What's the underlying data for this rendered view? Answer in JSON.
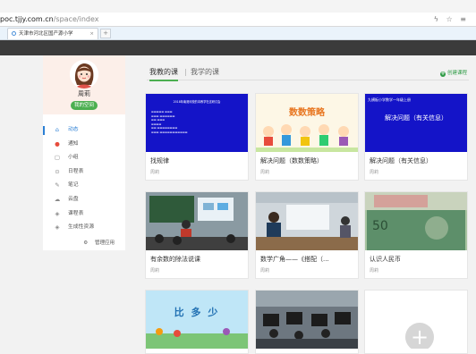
{
  "browser": {
    "url_host": "poc.tjjy.com.cn",
    "url_path": "/space/index",
    "tab_title": "天津市河北区国产源小学",
    "tab_close": "×",
    "new_tab": "+",
    "addr_icons": "ϟ ☆ ≡"
  },
  "user": {
    "name": "周莉",
    "home_button": "我的空间"
  },
  "sidebar": {
    "items": [
      {
        "icon": "home-icon",
        "glyph": "⌂",
        "label": "动态"
      },
      {
        "icon": "bell-icon",
        "glyph": "●",
        "label": "通知"
      },
      {
        "icon": "group-icon",
        "glyph": "▢",
        "label": "小组"
      },
      {
        "icon": "calendar-icon",
        "glyph": "⊙",
        "label": "日程表"
      },
      {
        "icon": "pen-icon",
        "glyph": "✎",
        "label": "笔记"
      },
      {
        "icon": "cloud-icon",
        "glyph": "☁",
        "label": "云盘"
      },
      {
        "icon": "course-icon",
        "glyph": "◈",
        "label": "课程表"
      },
      {
        "icon": "resource-icon",
        "glyph": "◈",
        "label": "生成性资源"
      }
    ],
    "manage": {
      "glyph": "⚙",
      "label": "管理应用"
    }
  },
  "course_tabs": {
    "mine": "我教的课",
    "learn": "我学的课",
    "separator": "|",
    "create": "创建课程",
    "create_glyph": "+"
  },
  "courses": [
    {
      "title": "找规律",
      "author": "周莉",
      "thumb": "blue-text-slide",
      "thumb_title": "2018年南港河校的本教学在这研讨会"
    },
    {
      "title": "解决问题（数数策略）",
      "author": "周莉",
      "thumb": "kids-cartoon",
      "thumb_title": "数数策略"
    },
    {
      "title": "解决问题（有关信息）",
      "author": "周莉",
      "thumb": "blue-slide",
      "thumb_title": "解决问题（有关信息）",
      "thumb_sub": "九横板小学数学一年级上册"
    },
    {
      "title": "有余数的除法说课",
      "author": "周莉",
      "thumb": "classroom-photo"
    },
    {
      "title": "数学广角——《搭配（...",
      "author": "周莉",
      "thumb": "teacher-photo"
    },
    {
      "title": "认识人民币",
      "author": "周莉",
      "thumb": "banknote"
    },
    {
      "title": "",
      "author": "",
      "thumb": "bi-duo-shao",
      "thumb_title": "比 多 少"
    },
    {
      "title": "",
      "author": "",
      "thumb": "computer-lab-photo"
    },
    {
      "title": "",
      "author": "",
      "thumb": "add-course",
      "thumb_title": "+"
    }
  ],
  "colors": {
    "accent": "#4caf50",
    "active": "#2b7fd4",
    "topbar": "#3b3b3b",
    "slide_blue": "#1414c8"
  }
}
